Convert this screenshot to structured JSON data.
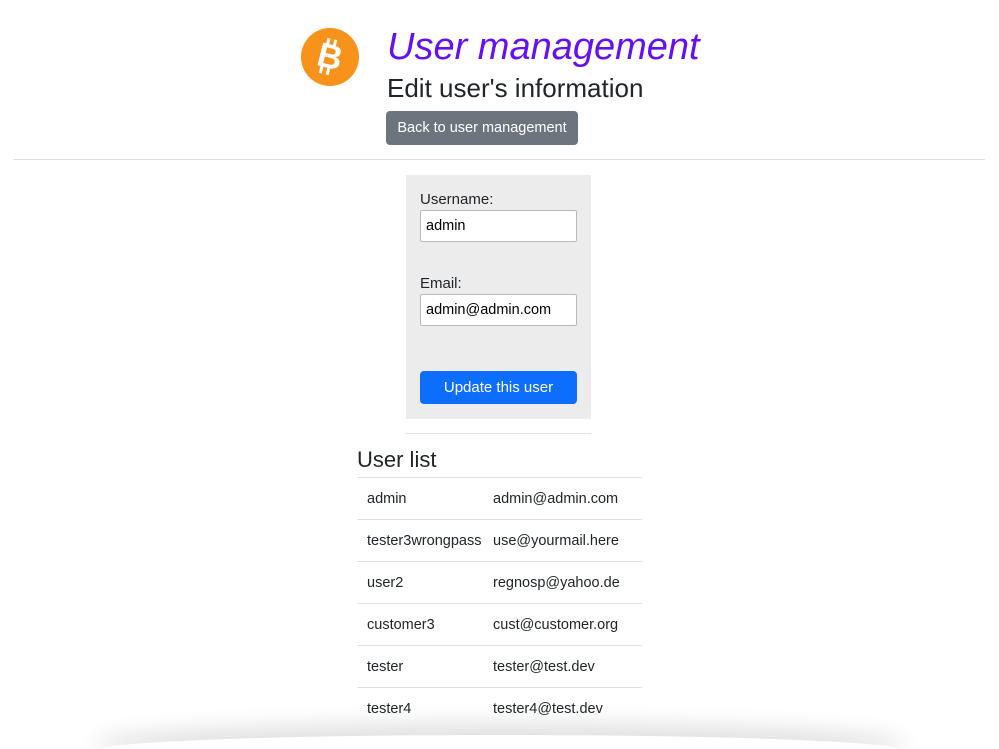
{
  "header": {
    "logo_icon": "bitcoin-icon",
    "logo_color": "#f7931a",
    "title": "User management",
    "title_color": "#6610f2",
    "subtitle": "Edit user's information",
    "back_button": "Back to user management"
  },
  "edit_form": {
    "username_label": "Username:",
    "username_value": "admin",
    "email_label": "Email:",
    "email_value": "admin@admin.com",
    "submit_label": "Update this user",
    "submit_color": "#0d6efd"
  },
  "user_list": {
    "heading": "User list",
    "rows": [
      {
        "username": "admin",
        "email": "admin@admin.com"
      },
      {
        "username": "tester3wrongpass",
        "email": "use@yourmail.here"
      },
      {
        "username": "user2",
        "email": "regnosp@yahoo.de"
      },
      {
        "username": "customer3",
        "email": "cust@customer.org"
      },
      {
        "username": "tester",
        "email": "tester@test.dev"
      },
      {
        "username": "tester4",
        "email": "tester4@test.dev"
      }
    ]
  }
}
